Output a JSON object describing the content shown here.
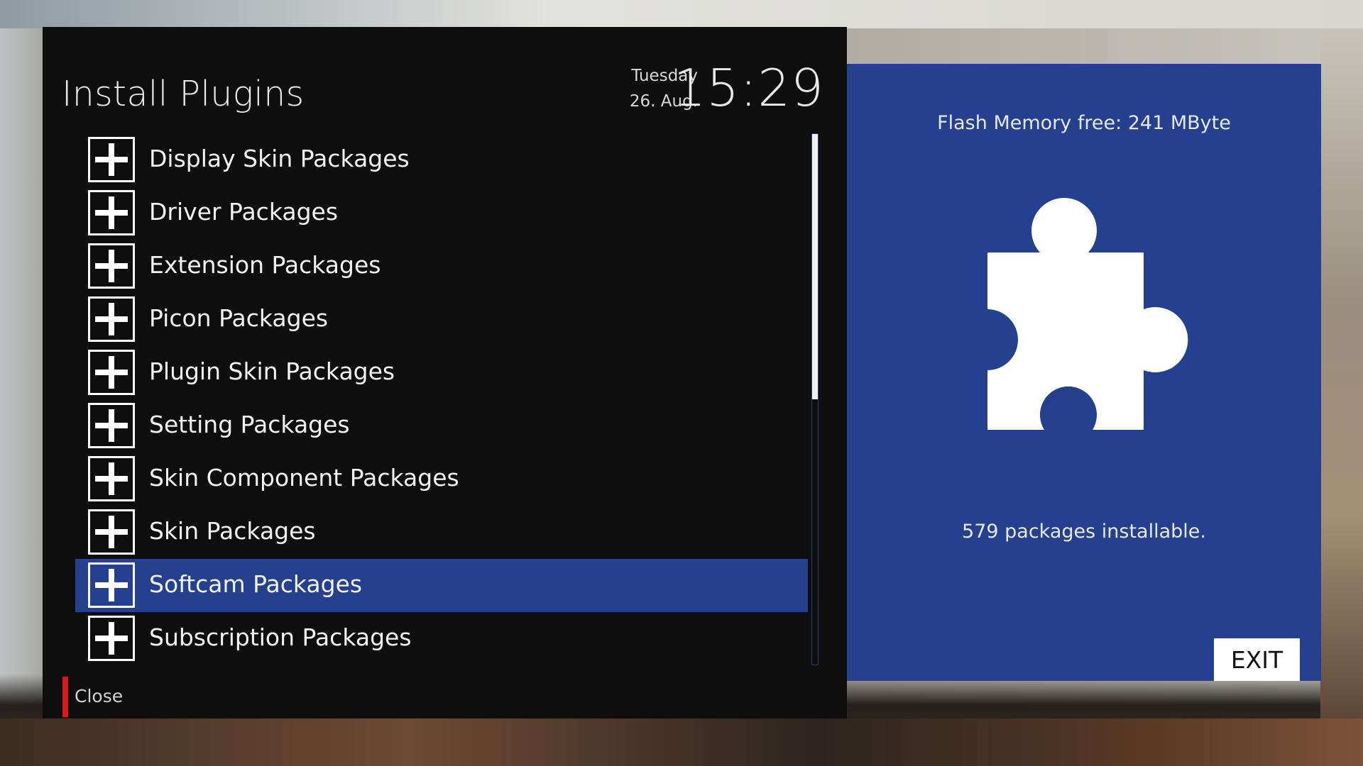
{
  "window": {
    "title": "Install Plugins"
  },
  "clock": {
    "day": "Tuesday",
    "date": "26. Aug.",
    "time": "15:29"
  },
  "list": {
    "items": [
      {
        "label": "Display Skin Packages",
        "icon": "plus-icon",
        "selected": false
      },
      {
        "label": "Driver Packages",
        "icon": "plus-icon",
        "selected": false
      },
      {
        "label": "Extension Packages",
        "icon": "plus-icon",
        "selected": false
      },
      {
        "label": "Picon Packages",
        "icon": "plus-icon",
        "selected": false
      },
      {
        "label": "Plugin Skin Packages",
        "icon": "plus-icon",
        "selected": false
      },
      {
        "label": "Setting Packages",
        "icon": "plus-icon",
        "selected": false
      },
      {
        "label": "Skin Component Packages",
        "icon": "plus-icon",
        "selected": false
      },
      {
        "label": "Skin Packages",
        "icon": "plus-icon",
        "selected": false
      },
      {
        "label": "Softcam Packages",
        "icon": "plus-icon",
        "selected": true
      },
      {
        "label": "Subscription Packages",
        "icon": "plus-icon",
        "selected": false
      }
    ],
    "scroll_fraction_visible": 0.5
  },
  "footer": {
    "close_label": "Close",
    "close_color": "#d41b1b"
  },
  "info_panel": {
    "flash_memory": "Flash Memory free: 241 MByte",
    "icon": "puzzle-piece-icon",
    "packages_count": "579 packages installable.",
    "exit_label": "EXIT"
  },
  "colors": {
    "panel_bg": "#0e0e0e",
    "accent": "#24408e",
    "text": "#f2f2f2"
  }
}
